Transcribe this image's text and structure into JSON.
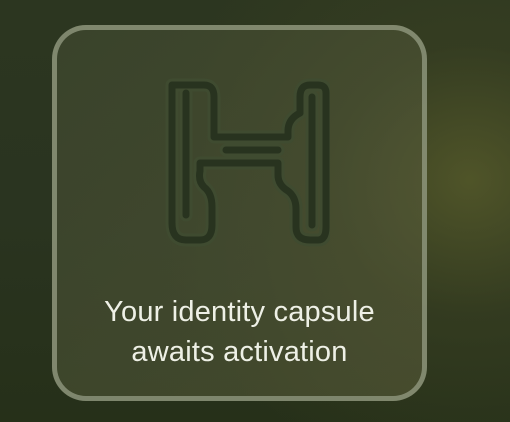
{
  "capsule": {
    "logo": "h-pipe-logo",
    "logo_color": "#28331f",
    "logo_outline_color": "#3f4b30",
    "message_line1": "Your identity capsule",
    "message_line2": "awaits activation"
  },
  "colors": {
    "background": "#2b3520",
    "card_border": "#969e84",
    "text": "#eef0e6"
  }
}
